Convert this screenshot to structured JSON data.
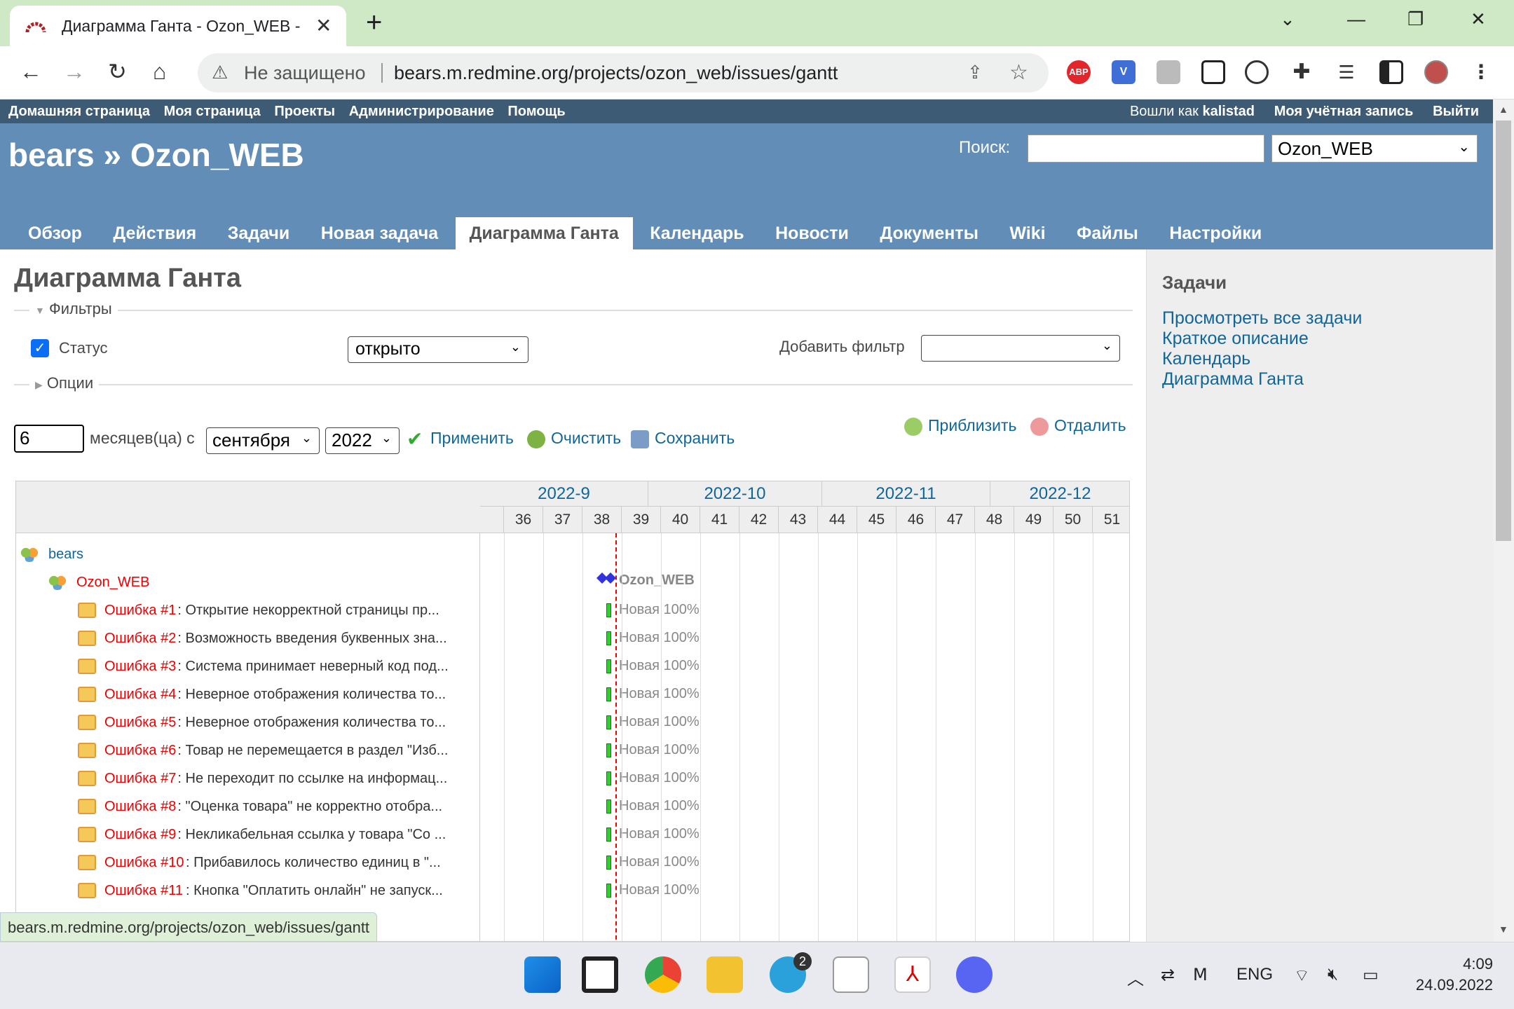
{
  "browser": {
    "tab_title": "Диаграмма Ганта - Ozon_WEB -",
    "tab_close": "✕",
    "new_tab": "+",
    "insecure_label": "Не защищено",
    "url": "bears.m.redmine.org/projects/ozon_web/issues/gantt",
    "extensions": [
      {
        "name": "adblock-plus-icon",
        "text": "ABP",
        "color": "#e3262a"
      },
      {
        "name": "v-extension-icon",
        "text": "V",
        "color": "#3f6fd6"
      }
    ]
  },
  "topmenu": {
    "items": [
      "Домашняя страница",
      "Моя страница",
      "Проекты",
      "Администрирование",
      "Помощь"
    ],
    "logged_in_prefix": "Вошли как",
    "user": "kalistad",
    "my_account": "Моя учётная запись",
    "logout": "Выйти"
  },
  "header": {
    "title": "bears » Ozon_WEB",
    "search_label": "Поиск:",
    "project_select": "Ozon_WEB"
  },
  "mainmenu": {
    "tabs": [
      "Обзор",
      "Действия",
      "Задачи",
      "Новая задача",
      "Диаграмма Ганта",
      "Календарь",
      "Новости",
      "Документы",
      "Wiki",
      "Файлы",
      "Настройки"
    ],
    "selected": "Диаграмма Ганта"
  },
  "page": {
    "title": "Диаграмма Ганта",
    "filters_label": "Фильтры",
    "status_label": "Статус",
    "status_value": "открыто",
    "add_filter_label": "Добавить фильтр",
    "options_label": "Опции",
    "months_value": "6",
    "months_label": "месяцев(ца) с",
    "month_select": "сентября",
    "year_select": "2022",
    "apply": "Применить",
    "clear": "Очистить",
    "save": "Сохранить",
    "zoom_in": "Приблизить",
    "zoom_out": "Отдалить"
  },
  "gantt": {
    "months": [
      "2022-9",
      "2022-10",
      "2022-11",
      "2022-12"
    ],
    "weeks": [
      "36",
      "37",
      "38",
      "39",
      "40",
      "41",
      "42",
      "43",
      "44",
      "45",
      "46",
      "47",
      "48",
      "49",
      "50",
      "51"
    ],
    "root_project": "bears",
    "project": "Ozon_WEB",
    "project_label": "Ozon_WEB",
    "issue_status_label": "Новая 100%",
    "issues": [
      {
        "ref": "Ошибка #1",
        "subject": ": Открытие некорректной страницы пр..."
      },
      {
        "ref": "Ошибка #2",
        "subject": ": Возможность введения буквенных зна..."
      },
      {
        "ref": "Ошибка #3",
        "subject": ": Система принимает неверный код под..."
      },
      {
        "ref": "Ошибка #4",
        "subject": ": Неверное отображения количества то..."
      },
      {
        "ref": "Ошибка #5",
        "subject": ": Неверное отображения количества то..."
      },
      {
        "ref": "Ошибка #6",
        "subject": ": Товар не перемещается в раздел \"Изб..."
      },
      {
        "ref": "Ошибка #7",
        "subject": ": Не переходит по ссылке на информац..."
      },
      {
        "ref": "Ошибка #8",
        "subject": ": \"Оценка товара\" не корректно отобра..."
      },
      {
        "ref": "Ошибка #9",
        "subject": ": Некликабельная ссылка у товара \"Со ..."
      },
      {
        "ref": "Ошибка #10",
        "subject": ": Прибавилось количество единиц в \"..."
      },
      {
        "ref": "Ошибка #11",
        "subject": ": Кнопка \"Оплатить онлайн\" не запуск..."
      }
    ]
  },
  "sidebar": {
    "title": "Задачи",
    "links": [
      "Просмотреть все задачи",
      "Краткое описание",
      "Календарь",
      "Диаграмма Ганта"
    ]
  },
  "statusbar_url": "bears.m.redmine.org/projects/ozon_web/issues/gantt",
  "taskbar": {
    "telegram_badge": "2",
    "lang": "ENG",
    "time": "4:09",
    "date": "24.09.2022"
  }
}
